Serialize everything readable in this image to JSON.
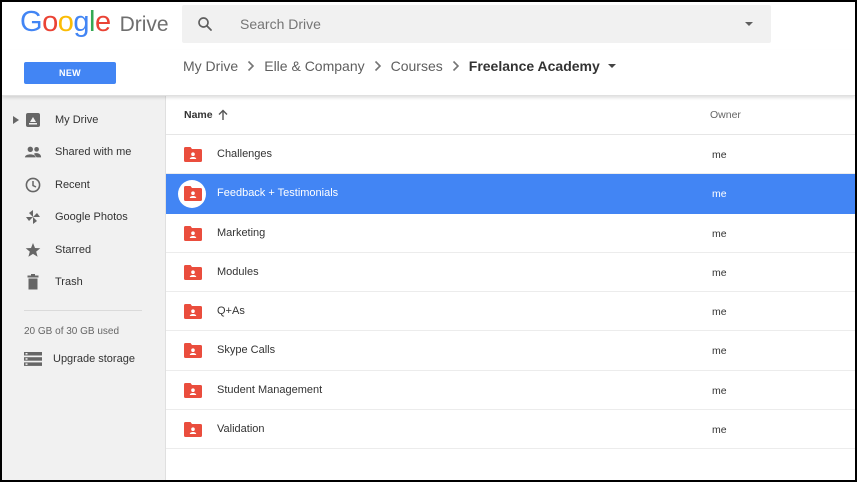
{
  "app": {
    "logo_google": [
      "G",
      "o",
      "o",
      "g",
      "l",
      "e"
    ],
    "logo_colors": [
      "#4285f4",
      "#ea4335",
      "#fbbc05",
      "#4285f4",
      "#34a853",
      "#ea4335"
    ],
    "logo_product": "Drive"
  },
  "search": {
    "placeholder": "Search Drive",
    "value": ""
  },
  "toolbar": {
    "new_label": "NEW"
  },
  "breadcrumb": {
    "items": [
      "My Drive",
      "Elle & Company",
      "Courses"
    ],
    "current": "Freelance Academy"
  },
  "sidebar": {
    "items": [
      {
        "label": "My Drive",
        "icon": "drive-icon"
      },
      {
        "label": "Shared with me",
        "icon": "shared-people-icon"
      },
      {
        "label": "Recent",
        "icon": "clock-icon"
      },
      {
        "label": "Google Photos",
        "icon": "photos-pinwheel-icon"
      },
      {
        "label": "Starred",
        "icon": "star-icon"
      },
      {
        "label": "Trash",
        "icon": "trash-icon"
      }
    ],
    "storage_text": "20 GB of 30 GB used",
    "upgrade_label": "Upgrade storage"
  },
  "list": {
    "col_name": "Name",
    "col_owner": "Owner",
    "selected_index": 1,
    "rows": [
      {
        "name": "Challenges",
        "owner": "me"
      },
      {
        "name": "Feedback + Testimonials",
        "owner": "me"
      },
      {
        "name": "Marketing",
        "owner": "me"
      },
      {
        "name": "Modules",
        "owner": "me"
      },
      {
        "name": "Q+As",
        "owner": "me"
      },
      {
        "name": "Skype Calls",
        "owner": "me"
      },
      {
        "name": "Student Management",
        "owner": "me"
      },
      {
        "name": "Validation",
        "owner": "me"
      }
    ]
  },
  "colors": {
    "accent": "#4285f4",
    "folder": "#ea4d3d",
    "sidebar_bg": "#f1f1f1"
  }
}
